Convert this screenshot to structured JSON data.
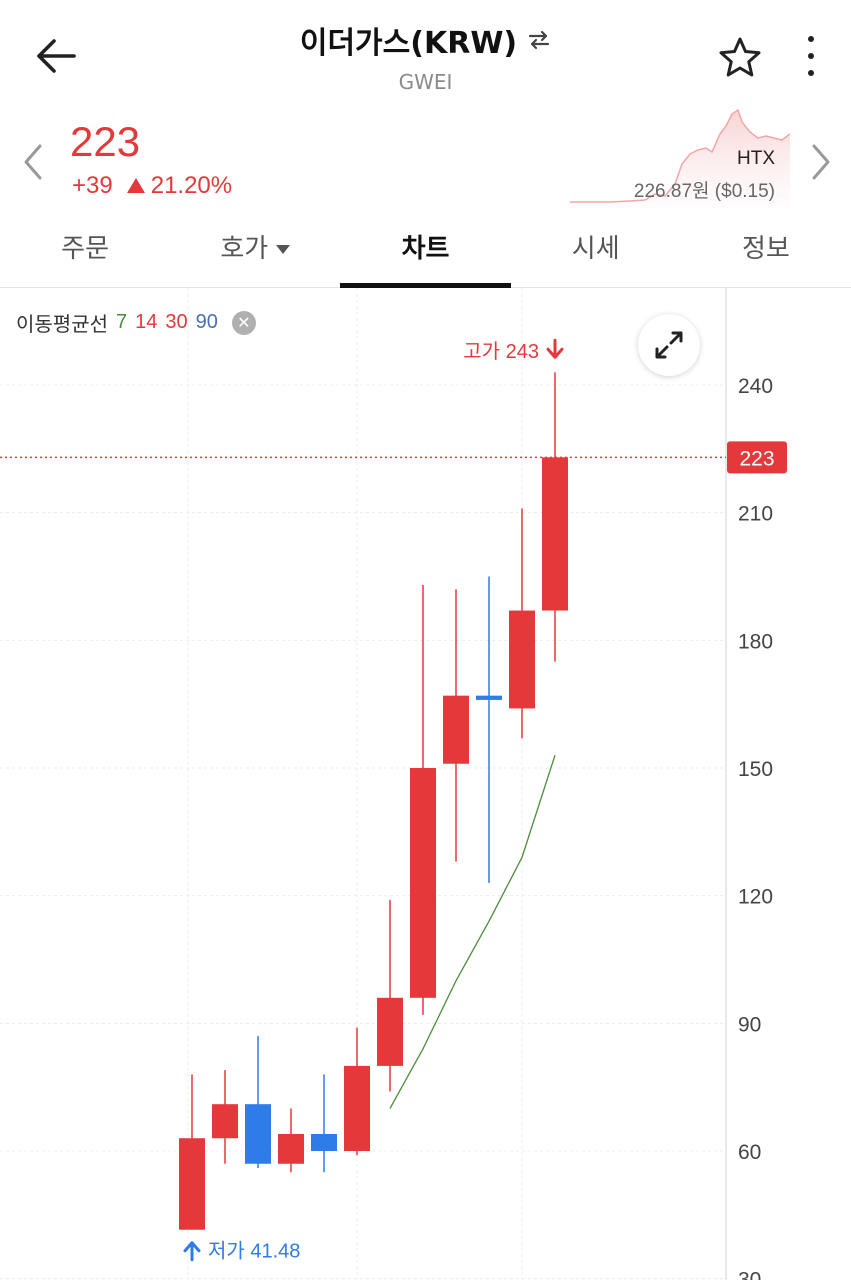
{
  "header": {
    "title": "이더가스(KRW)",
    "subtitle": "GWEI"
  },
  "price": {
    "current": "223",
    "change": "+39",
    "change_pct": "21.20%",
    "exchange": "HTX",
    "ref_price": "226.87원 ($0.15)"
  },
  "tabs": [
    {
      "label": "주문"
    },
    {
      "label": "호가"
    },
    {
      "label": "차트"
    },
    {
      "label": "시세"
    },
    {
      "label": "정보"
    }
  ],
  "ma_legend": {
    "label": "이동평균선",
    "periods": [
      "7",
      "14",
      "30",
      "90"
    ]
  },
  "colors": {
    "up": "#e5383b",
    "down": "#2f7bea",
    "ma7": "#4c8c3c",
    "ma14": "#e5383b",
    "ma30": "#e5383b",
    "ma90": "#4a6fb3"
  },
  "chart_data": {
    "type": "candlestick",
    "y_ticks": [
      30,
      60,
      90,
      120,
      150,
      180,
      210,
      240
    ],
    "ylim": [
      30,
      270
    ],
    "current_price": 223,
    "current_price_label": "223",
    "high_annotation": "고가 243",
    "low_annotation": "저가 41.48",
    "candles": [
      {
        "open": 41.5,
        "high": 78,
        "low": 41.5,
        "close": 63
      },
      {
        "open": 63,
        "high": 79,
        "low": 57,
        "close": 71
      },
      {
        "open": 71,
        "high": 87,
        "low": 56,
        "close": 57
      },
      {
        "open": 57,
        "high": 70,
        "low": 55,
        "close": 64
      },
      {
        "open": 64,
        "high": 78,
        "low": 55,
        "close": 60
      },
      {
        "open": 60,
        "high": 89,
        "low": 59,
        "close": 80
      },
      {
        "open": 80,
        "high": 119,
        "low": 74,
        "close": 96
      },
      {
        "open": 96,
        "high": 193,
        "low": 92,
        "close": 150
      },
      {
        "open": 151,
        "high": 192,
        "low": 128,
        "close": 167
      },
      {
        "open": 167,
        "high": 195,
        "low": 123,
        "close": 166
      },
      {
        "open": 164,
        "high": 211,
        "low": 157,
        "close": 187
      },
      {
        "open": 187,
        "high": 243,
        "low": 175,
        "close": 223
      }
    ],
    "ma7": [
      null,
      null,
      null,
      null,
      null,
      null,
      70,
      84,
      100,
      114,
      129,
      153
    ]
  }
}
